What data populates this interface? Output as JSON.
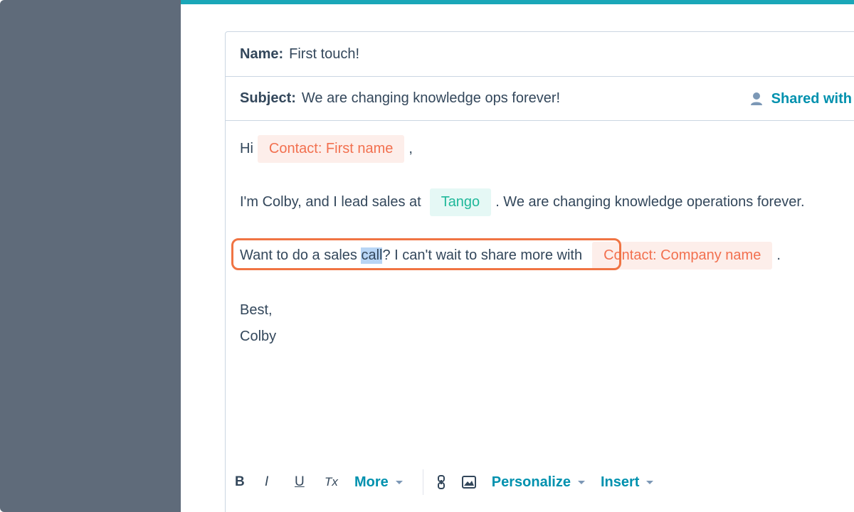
{
  "editor": {
    "name_label": "Name:",
    "name_value": "First touch!",
    "subject_label": "Subject:",
    "subject_value": "We are changing knowledge ops forever!",
    "shared_label": "Shared with"
  },
  "body": {
    "greeting": "Hi",
    "token_first_name": "Contact: First name",
    "comma": ",",
    "line2_prefix": "I'm Colby, and I lead sales at",
    "token_company": "Tango",
    "line2_suffix": ". We are changing knowledge operations forever.",
    "line3_prefix": "Want to do a sales ",
    "line3_selected": "call",
    "line3_suffix": "? I can't wait to share more with",
    "token_company_name": "Contact: Company name",
    "period": ".",
    "signoff": "Best,",
    "signature": "Colby"
  },
  "toolbar": {
    "bold": "B",
    "italic": "I",
    "underline": "U",
    "clear_format": "Tx",
    "more_label": "More",
    "personalize_label": "Personalize",
    "insert_label": "Insert"
  },
  "colors": {
    "sidebar": "#5f6b7a",
    "accent": "#1aa7b8",
    "link": "#0091ae",
    "highlight_outline": "#f07443",
    "contact_token_text": "#f2704f",
    "company_token_text": "#1fb89a"
  }
}
